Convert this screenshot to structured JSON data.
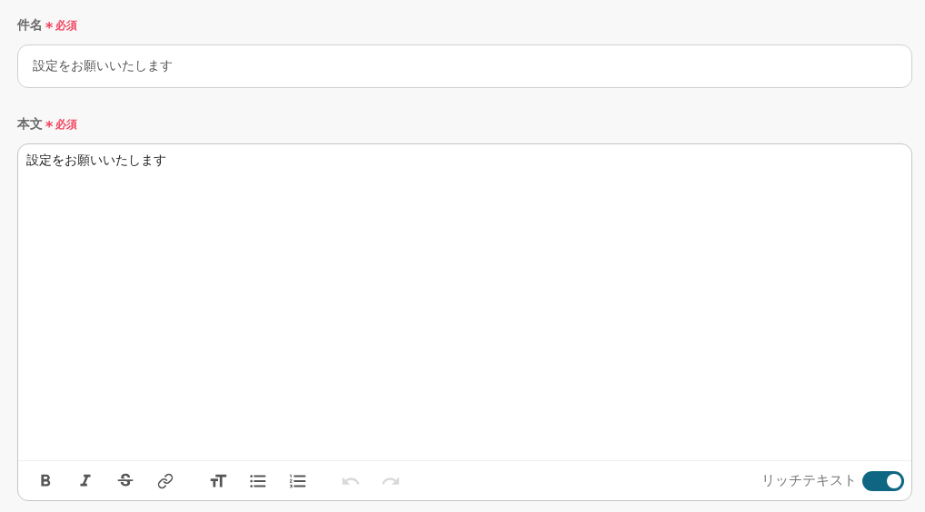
{
  "fields": [
    {
      "kind": "input",
      "label": "件名",
      "required_mark": "*",
      "required_text": "必須",
      "value": "設定をお願いいたします"
    },
    {
      "kind": "editor",
      "label": "本文",
      "required_mark": "*",
      "required_text": "必須",
      "value": "設定をお願いいたします",
      "toolbar": [
        {
          "kind": "bold",
          "disabled": false
        },
        {
          "kind": "italic",
          "disabled": false
        },
        {
          "kind": "strike",
          "disabled": false
        },
        {
          "kind": "link",
          "disabled": false
        },
        {
          "kind": "size",
          "disabled": false
        },
        {
          "kind": "bullets",
          "disabled": false
        },
        {
          "kind": "numbers",
          "disabled": false
        },
        {
          "kind": "undo",
          "disabled": true
        },
        {
          "kind": "redo",
          "disabled": true
        }
      ],
      "toggle": {
        "label": "リッチテキスト",
        "on": true
      }
    }
  ]
}
